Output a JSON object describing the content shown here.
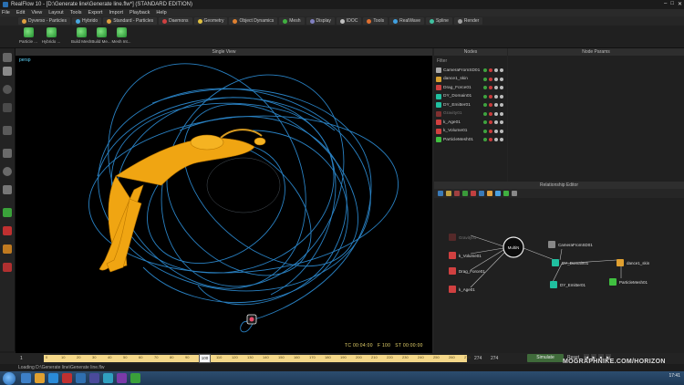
{
  "window": {
    "title": "RealFlow 10 - [D:\\Generate line\\Generate line.flw*] (STANDARD EDITION)"
  },
  "menu": [
    "File",
    "Edit",
    "View",
    "Layout",
    "Tools",
    "Export",
    "Import",
    "Playback",
    "Help"
  ],
  "tabs": [
    {
      "label": "Dyverso - Particles",
      "color": "#e0a040"
    },
    {
      "label": "Hybrido",
      "color": "#4aa8e0"
    },
    {
      "label": "Standard - Particles",
      "color": "#e0a040"
    },
    {
      "label": "Daemons",
      "color": "#d04040"
    },
    {
      "label": "Geometry",
      "color": "#e0c040"
    },
    {
      "label": "Object Dynamics",
      "color": "#e08030"
    },
    {
      "label": "Mesh",
      "color": "#40b040"
    },
    {
      "label": "Display",
      "color": "#8080c0"
    },
    {
      "label": "IDOC",
      "color": "#c0c0c0"
    },
    {
      "label": "Tools",
      "color": "#e07030"
    },
    {
      "label": "RealWave",
      "color": "#40a0e0"
    },
    {
      "label": "Spline",
      "color": "#40c0a0"
    },
    {
      "label": "Render",
      "color": "#a0a0a0"
    }
  ],
  "shelf": [
    "Particle ...",
    "Hybrido ...",
    "Build Mesh",
    "Build Me...",
    "Mesh Int..."
  ],
  "viewport": {
    "header": "Single View",
    "camera": "persp",
    "timecode": "TC 00:04:00",
    "frame": "F 100",
    "st": "ST 00:00:00"
  },
  "nodes": {
    "header": "Nodes",
    "filter": "Filter",
    "items": [
      {
        "label": "CameraFromSD01",
        "color": "#aaaaaa",
        "dim": false
      },
      {
        "label": "dance1_skin",
        "color": "#d8a030",
        "dim": false
      },
      {
        "label": "Drag_Force01",
        "color": "#d04040",
        "dim": false
      },
      {
        "label": "DY_Domain01",
        "color": "#20c0a0",
        "dim": false
      },
      {
        "label": "DY_Emitter01",
        "color": "#20c0a0",
        "dim": false
      },
      {
        "label": "Gravity01",
        "color": "#803030",
        "dim": true
      },
      {
        "label": "k_Age01",
        "color": "#d04040",
        "dim": false
      },
      {
        "label": "k_Volume01",
        "color": "#d04040",
        "dim": false
      },
      {
        "label": "ParticleMesh01",
        "color": "#40c040",
        "dim": false
      }
    ]
  },
  "params": {
    "header": "Node Params"
  },
  "relationship": {
    "header": "Relationship Editor",
    "hub": "MultiN",
    "nodes": [
      {
        "label": "Gravity01",
        "color": "#7a3030",
        "dim": true
      },
      {
        "label": "k_Volume01",
        "color": "#d04040",
        "dim": false
      },
      {
        "label": "Drag_Force01",
        "color": "#d04040",
        "dim": false
      },
      {
        "label": "k_Age01",
        "color": "#d04040",
        "dim": false
      },
      {
        "label": "CameraFromSD01",
        "color": "#888888",
        "dim": false
      },
      {
        "label": "DY_Domain01",
        "color": "#20c0a0",
        "dim": false
      },
      {
        "label": "dance1_skin",
        "color": "#e0a030",
        "dim": false
      },
      {
        "label": "DY_Emitter01",
        "color": "#20c0a0",
        "dim": false
      },
      {
        "label": "ParticleMesh01",
        "color": "#40c040",
        "dim": false
      }
    ]
  },
  "timeline": {
    "ticks": [
      "0",
      "10",
      "20",
      "30",
      "40",
      "50",
      "60",
      "70",
      "80",
      "90",
      "100",
      "110",
      "120",
      "130",
      "140",
      "150",
      "160",
      "170",
      "180",
      "190",
      "200",
      "210",
      "220",
      "230",
      "240",
      "250",
      "260",
      "270"
    ],
    "current": "100",
    "end_a": "274",
    "end_b": "274",
    "start": "1",
    "simulate": "Simulate",
    "reset": "Reset"
  },
  "status": "Loading D:\\Generate line\\Generate line.flw",
  "watermark": "MOGRAPHNIKE.COM/HORIZON",
  "clock": {
    "time": "17:41"
  }
}
